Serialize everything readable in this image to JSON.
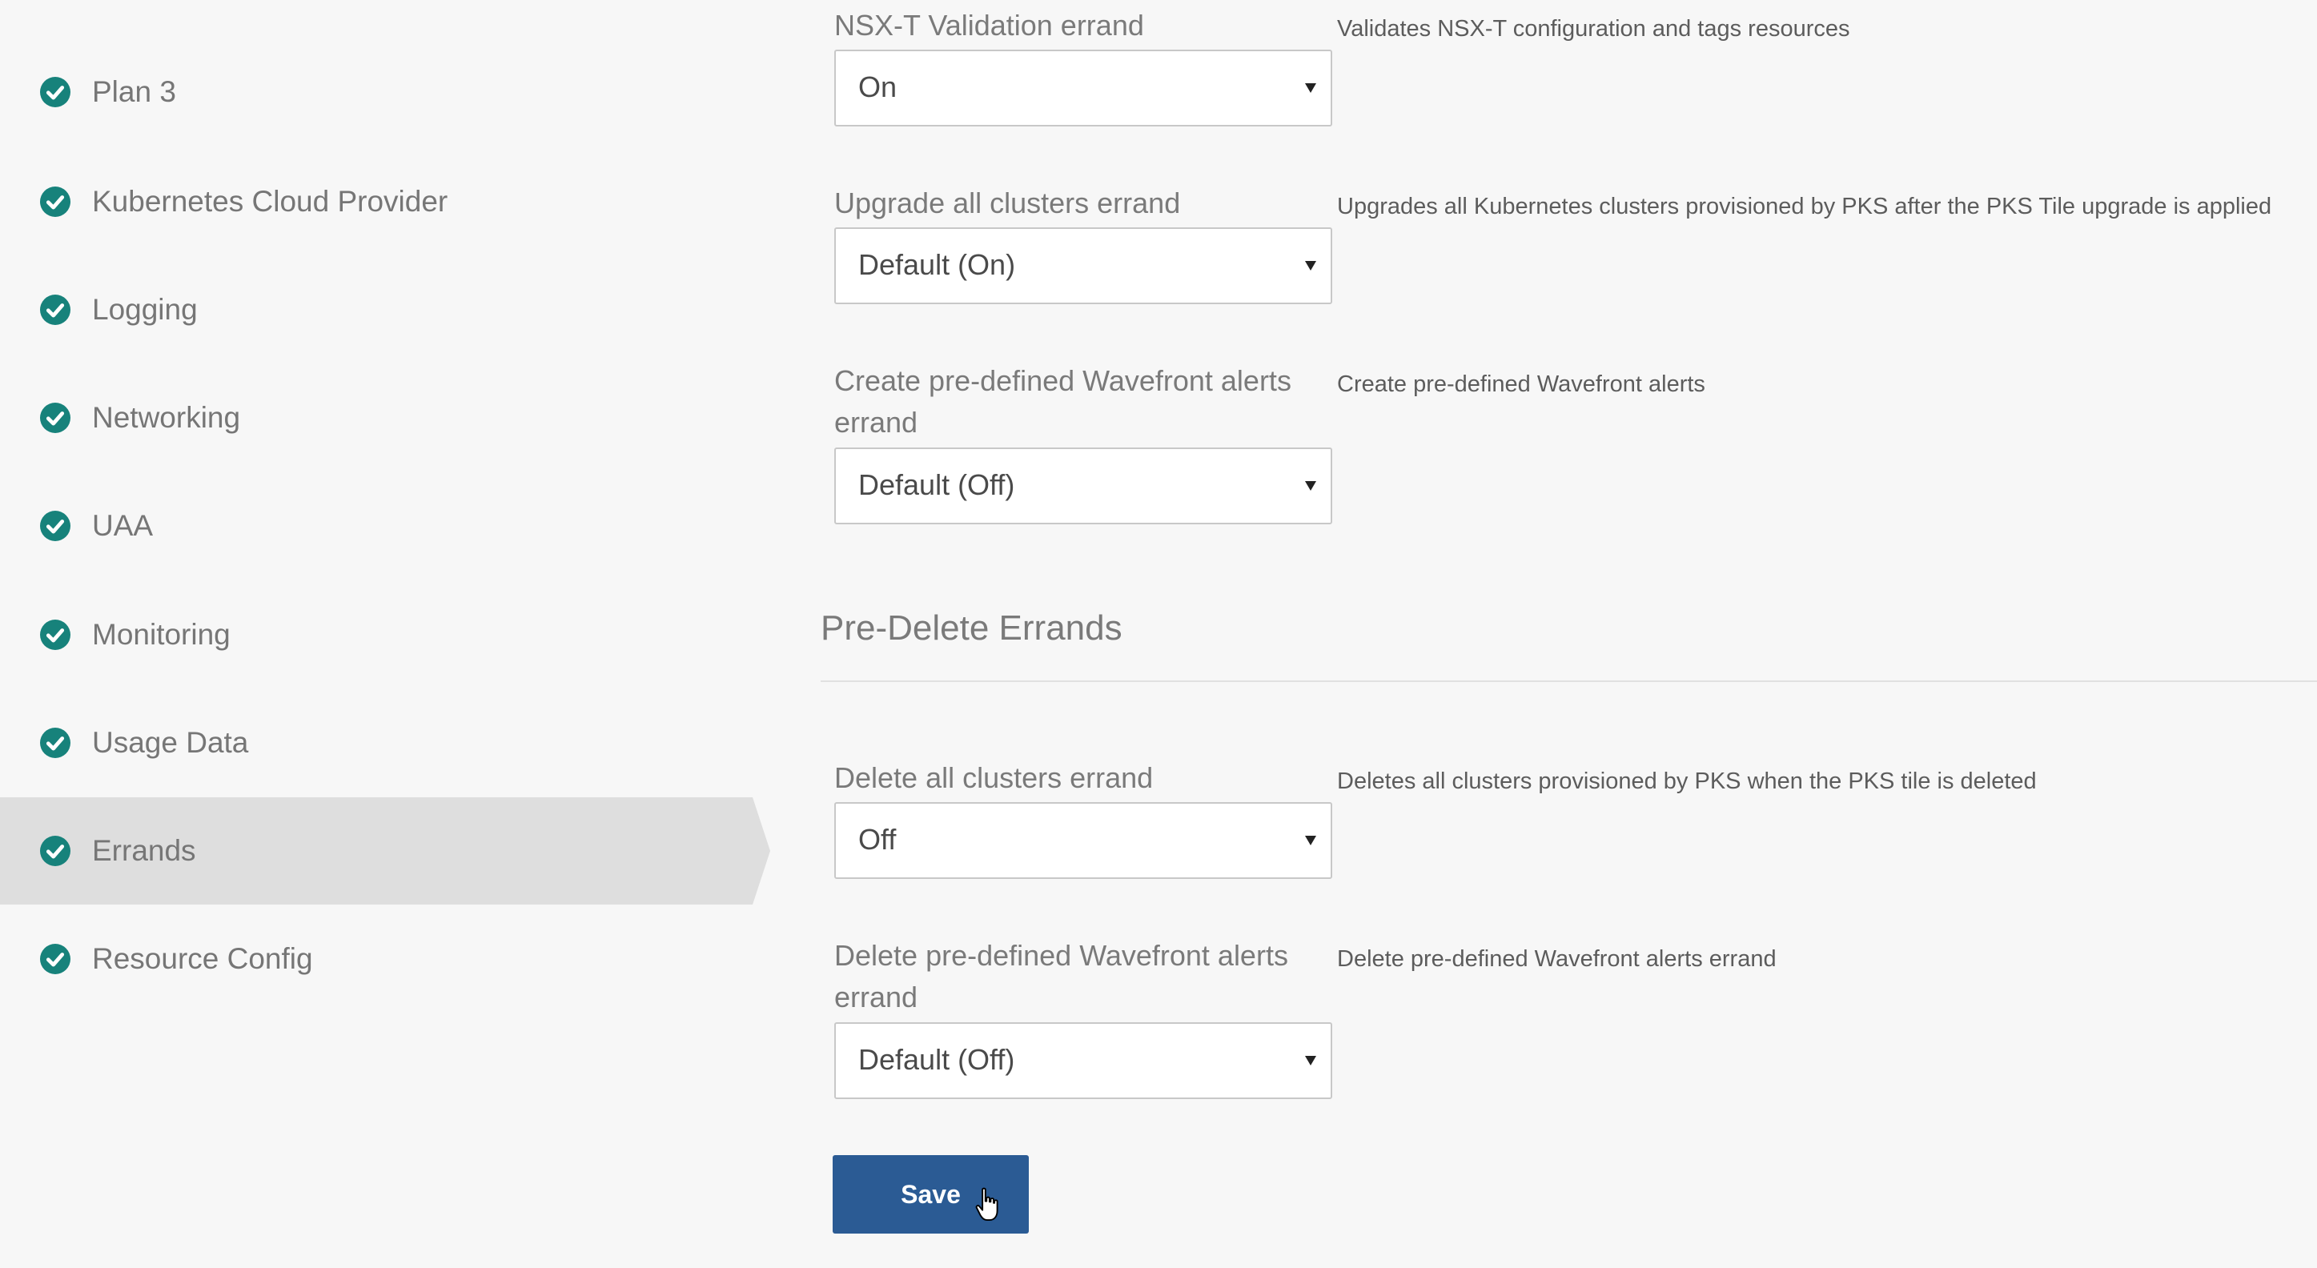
{
  "sidebar": {
    "items": [
      {
        "label": "Plan 3"
      },
      {
        "label": "Kubernetes Cloud Provider"
      },
      {
        "label": "Logging"
      },
      {
        "label": "Networking"
      },
      {
        "label": "UAA"
      },
      {
        "label": "Monitoring"
      },
      {
        "label": "Usage Data"
      },
      {
        "label": "Errands",
        "active": true
      },
      {
        "label": "Resource Config"
      }
    ],
    "check_icon": "check-circle-icon",
    "check_color": "#17827b",
    "active_background": "#dedede"
  },
  "errands": {
    "nsxt": {
      "label": "NSX-T Validation errand",
      "value": "On",
      "description": "Validates NSX-T configuration and tags resources"
    },
    "upgrade_all": {
      "label": "Upgrade all clusters errand",
      "value": "Default (On)",
      "description": "Upgrades all Kubernetes clusters provisioned by PKS after the PKS Tile upgrade is applied"
    },
    "wavefront_create": {
      "label": "Create pre-defined Wavefront alerts errand",
      "value": "Default (Off)",
      "description": "Create pre-defined Wavefront alerts"
    }
  },
  "pre_delete": {
    "title": "Pre-Delete Errands",
    "delete_all": {
      "label": "Delete all clusters errand",
      "value": "Off",
      "description": "Deletes all clusters provisioned by PKS when the PKS tile is deleted"
    },
    "wavefront_delete": {
      "label": "Delete pre-defined Wavefront alerts errand",
      "value": "Default (Off)",
      "description": "Delete pre-defined Wavefront alerts errand"
    }
  },
  "save_button": {
    "label": "Save",
    "color": "#2b5b94"
  },
  "cursor_icon": "hand-pointer-icon"
}
